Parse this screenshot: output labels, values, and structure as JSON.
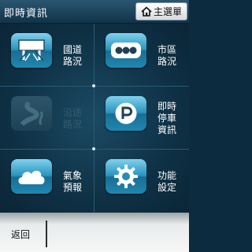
{
  "header": {
    "title": "即時資訊",
    "main_menu_label": "主選單",
    "main_menu_icon": "home-icon"
  },
  "menu": [
    {
      "id": "national-road",
      "label": "國道\n路況",
      "icon": "highway-sign-icon",
      "enabled": true
    },
    {
      "id": "city-road",
      "label": "市區\n路況",
      "icon": "traffic-light-icon",
      "enabled": true
    },
    {
      "id": "coastal-road",
      "label": "沿途\n路況",
      "icon": "winding-road-icon",
      "enabled": false
    },
    {
      "id": "parking",
      "label": "即時\n停車\n資訊",
      "icon": "parking-icon",
      "enabled": true
    },
    {
      "id": "weather",
      "label": "氣象\n預報",
      "icon": "cloud-icon",
      "enabled": true
    },
    {
      "id": "settings",
      "label": "功能\n設定",
      "icon": "gear-icon",
      "enabled": true
    }
  ],
  "footer": {
    "back_label": "返回"
  },
  "colors": {
    "accent": "#2a93bd",
    "background": "#0f3145",
    "disabled_text": "#355d71"
  }
}
